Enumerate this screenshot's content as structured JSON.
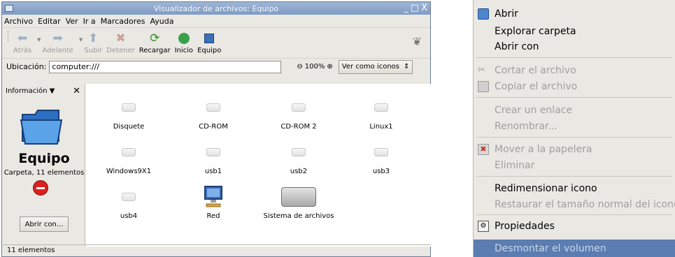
{
  "window": {
    "title": "Visualizador de archivos: Equipo",
    "controls": [
      "_",
      "□",
      "X"
    ]
  },
  "menubar": [
    "Archivo",
    "Editar",
    "Ver",
    "Ir a",
    "Marcadores",
    "Ayuda"
  ],
  "toolbar": {
    "back": "Atrás",
    "forward": "Adelante",
    "up": "Subir",
    "stop": "Detener",
    "reload": "Recargar",
    "home": "Inicio",
    "computer": "Equipo"
  },
  "location": {
    "label": "Ubicación:",
    "value": "computer:///",
    "zoom": "100%",
    "view_mode": "Ver como iconos"
  },
  "sidebar": {
    "selector": "Información",
    "title": "Equipo",
    "subtitle": "Carpeta, 11 elementos",
    "open_with": "Abrir con..."
  },
  "items": [
    {
      "name": "Disquete",
      "icon": "drive-icon"
    },
    {
      "name": "CD-ROM",
      "icon": "drive-icon"
    },
    {
      "name": "CD-ROM 2",
      "icon": "drive-icon"
    },
    {
      "name": "Linux1",
      "icon": "drive-icon"
    },
    {
      "name": "Windows9X1",
      "icon": "drive-icon"
    },
    {
      "name": "usb1",
      "icon": "drive-icon"
    },
    {
      "name": "usb2",
      "icon": "drive-icon"
    },
    {
      "name": "usb3",
      "icon": "drive-icon"
    },
    {
      "name": "usb4",
      "icon": "drive-icon"
    },
    {
      "name": "Red",
      "icon": "network-icon"
    },
    {
      "name": "Sistema de archivos",
      "icon": "harddisk-icon"
    }
  ],
  "status": "11 elementos",
  "context_menu": {
    "open": "Abrir",
    "explore": "Explorar carpeta",
    "open_with": "Abrir con",
    "cut": "Cortar el archivo",
    "copy": "Copiar el archivo",
    "link": "Crear un enlace",
    "rename": "Renombrar...",
    "trash": "Mover a la papelera",
    "delete": "Eliminar",
    "resize_icon": "Redimensionar icono",
    "restore_icon": "Restaurar el tamaño normal del icono",
    "properties": "Propiedades",
    "unmount": "Desmontar el volumen"
  }
}
